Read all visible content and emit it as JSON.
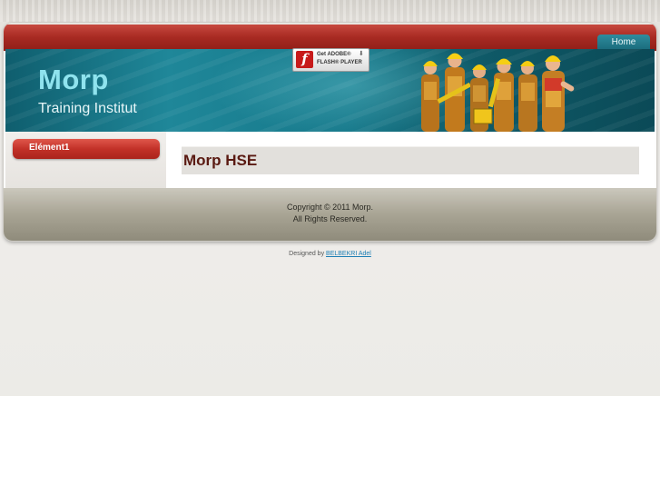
{
  "nav": {
    "home_label": "Home"
  },
  "header": {
    "title": "Morp",
    "slogan": "Training Institut"
  },
  "flash_badge": {
    "logo": "f",
    "line1": "Get ADOBE®",
    "line2": "FLASH® PLAYER",
    "arrow": "⬇"
  },
  "sidebar": {
    "items": [
      {
        "label": "Elément1"
      }
    ]
  },
  "main": {
    "heading": "Morp HSE"
  },
  "footer": {
    "copyright": "Copyright © 2011 Morp.",
    "rights": "All Rights Reserved."
  },
  "credit": {
    "prefix": "Designed by",
    "author": "BELBEKRI Adel"
  },
  "colors": {
    "topbar": "#a82a22",
    "banner": "#16788a",
    "heading": "#5a1a12",
    "link": "#1e7fb5"
  }
}
